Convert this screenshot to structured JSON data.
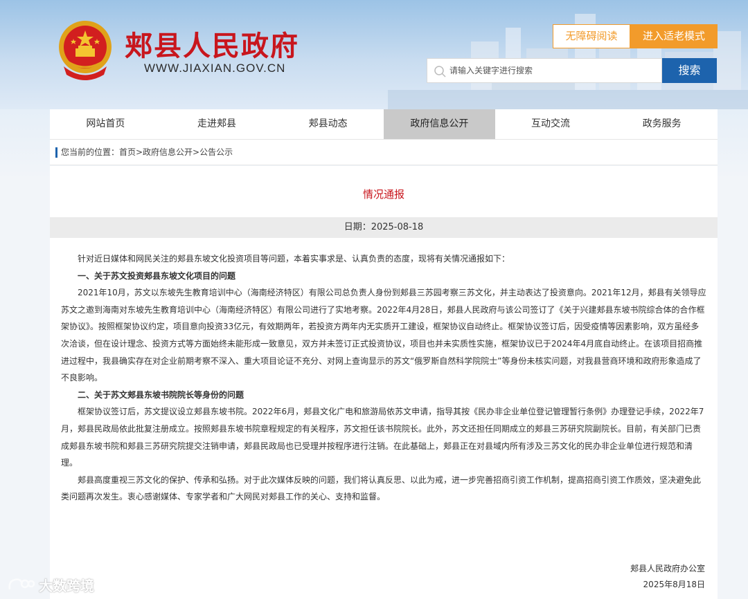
{
  "header": {
    "site_title": "郏县人民政府",
    "site_url": "WWW.JIAXIAN.GOV.CN",
    "accessible_label": "无障碍阅读",
    "elderly_mode_label": "进入适老模式",
    "search_placeholder": "请输入关键字进行搜索",
    "search_button": "搜索",
    "icons": [
      "national-emblem-icon",
      "search-icon"
    ],
    "accent_color": "#c8161d",
    "brand_blue": "#1d63ad",
    "orange": "#f29b2b"
  },
  "nav": {
    "items": [
      {
        "label": "网站首页"
      },
      {
        "label": "走进郏县"
      },
      {
        "label": "郏县动态"
      },
      {
        "label": "政府信息公开"
      },
      {
        "label": "互动交流"
      },
      {
        "label": "政务服务"
      }
    ],
    "active_index": 3
  },
  "breadcrumb": {
    "text": "您当前的位置：首页>政府信息公开>公告公示"
  },
  "article": {
    "title": "情况通报",
    "date": "日期：2025-08-18",
    "paragraphs": [
      "针对近日媒体和网民关注的郏县东坡文化投资项目等问题，本着实事求是、认真负责的态度，现将有关情况通报如下：",
      "一、关于苏文投资郏县东坡文化项目的问题",
      "2021年10月，苏文以东坡先生教育培训中心（海南经济特区）有限公司总负责人身份到郏县三苏园考察三苏文化，并主动表达了投资意向。2021年12月，郏县有关领导应苏文之邀到海南对东坡先生教育培训中心（海南经济特区）有限公司进行了实地考察。2022年4月28日，郏县人民政府与该公司签订了《关于兴建郏县东坡书院综合体的合作框架协议》。按照框架协议约定，项目意向投资33亿元，有效期两年，若投资方两年内无实质开工建设，框架协议自动终止。框架协议签订后，因受疫情等因素影响，双方虽经多次洽谈，但在设计理念、投资方式等方面始终未能形成一致意见，双方并未签订正式投资协议，项目也并未实质性实施，框架协议已于2024年4月底自动终止。在该项目招商推进过程中，我县确实存在对企业前期考察不深入、重大项目论证不充分、对网上查询显示的苏文“俄罗斯自然科学院院士”等身份未核实问题，对我县营商环境和政府形象造成了不良影响。",
      "二、关于苏文郏县东坡书院院长等身份的问题",
      "框架协议签订后，苏文提议设立郏县东坡书院。2022年6月，郏县文化广电和旅游局依苏文申请，指导其按《民办非企业单位登记管理暂行条例》办理登记手续，2022年7月，郏县民政局依此批复注册成立。按照郏县东坡书院章程规定的有关程序，苏文担任该书院院长。此外，苏文还担任同期成立的郏县三苏研究院副院长。目前，有关部门已责成郏县东坡书院和郏县三苏研究院提交注销申请，郏县民政局也已受理并按程序进行注销。在此基础上，郏县正在对县域内所有涉及三苏文化的民办非企业单位进行规范和清理。",
      "郏县高度重视三苏文化的保护、传承和弘扬。对于此次媒体反映的问题，我们将认真反思、以此为戒，进一步完善招商引资工作机制，提高招商引资工作质效，坚决避免此类问题再次发生。衷心感谢媒体、专家学者和广大网民对郏县工作的关心、支持和监督。"
    ],
    "signature": "郏县人民政府办公室",
    "signature_date": "2025年8月18日"
  },
  "watermark": {
    "text": "大数跨境"
  }
}
